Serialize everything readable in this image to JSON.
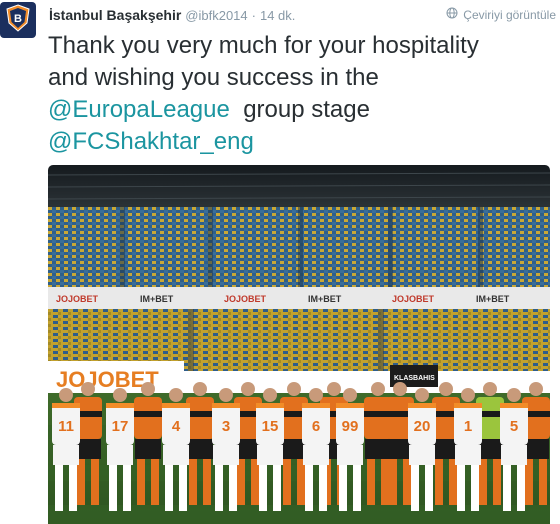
{
  "tweet": {
    "display_name": "İstanbul Başakşehir",
    "handle": "@ibfk2014",
    "separator": "·",
    "timestamp": "14 dk.",
    "translate_label": "Çeviriyi görüntüle",
    "text_line1": "Thank you very much for your hospitality",
    "text_line2": "and wishing you success in the",
    "mention1": "@EuropaLeague",
    "text_after_mention1": "group stage",
    "mention2": "@FCShakhtar_eng"
  },
  "photo": {
    "board_brand": "JOJOBET",
    "board_brand2": "IM+BET",
    "board_small": "KLASBAHIS",
    "jersey_numbers": [
      "11",
      "17",
      "4",
      "3",
      "15",
      "6",
      "99",
      "20",
      "1",
      "5"
    ]
  },
  "icons": {
    "avatar": "club-crest-icon",
    "translate": "globe-icon"
  },
  "colors": {
    "text": "#292f33",
    "muted": "#8899a6",
    "link": "#1b95a0",
    "crest": "#1b2f5e"
  }
}
